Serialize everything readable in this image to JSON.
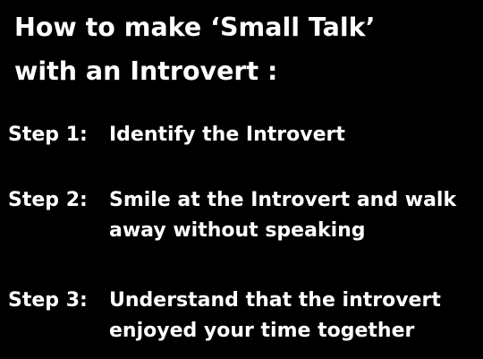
{
  "title": {
    "line1": "How to make ‘Small Talk’",
    "line2": "with an Introvert :"
  },
  "steps": [
    {
      "label": "Step 1:",
      "lines": [
        "Identify the Introvert"
      ]
    },
    {
      "label": "Step 2:",
      "lines": [
        "Smile at the Introvert and walk",
        "away without speaking"
      ]
    },
    {
      "label": "Step 3:",
      "lines": [
        "Understand that the introvert",
        "enjoyed your time together"
      ]
    }
  ]
}
